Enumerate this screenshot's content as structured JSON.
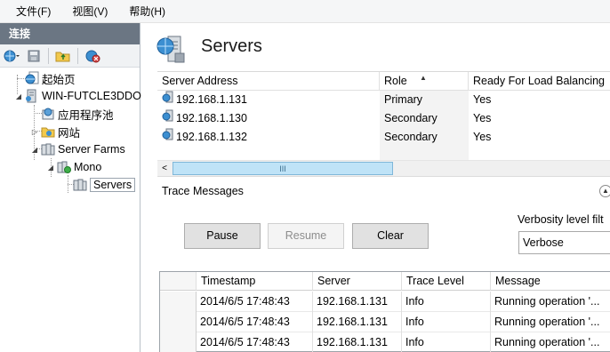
{
  "menu": {
    "items": [
      {
        "label": "文件(F)"
      },
      {
        "label": "视图(V)"
      },
      {
        "label": "帮助(H)"
      }
    ]
  },
  "left_pane": {
    "header": "连接",
    "toolbar_icons": [
      "globe-dropdown-icon",
      "save-icon",
      "folder-up-icon",
      "disconnect-icon"
    ],
    "tree": [
      {
        "label": "起始页",
        "icon": "globe-page-icon"
      },
      {
        "label": "WIN-FUTCLE3DDO",
        "icon": "server-icon"
      },
      {
        "label": "应用程序池",
        "icon": "app-pool-icon"
      },
      {
        "label": "网站",
        "icon": "sites-folder-icon"
      },
      {
        "label": "Server Farms",
        "icon": "server-farm-icon"
      },
      {
        "label": "Mono",
        "icon": "farm-node-icon"
      },
      {
        "label": "Servers",
        "icon": "servers-icon"
      }
    ]
  },
  "main": {
    "title": "Servers",
    "servers_grid": {
      "columns": [
        "Server Address",
        "Role",
        "Ready For Load Balancing"
      ],
      "rows": [
        {
          "address": "192.168.1.131",
          "role": "Primary",
          "ready": "Yes"
        },
        {
          "address": "192.168.1.130",
          "role": "Secondary",
          "ready": "Yes"
        },
        {
          "address": "192.168.1.132",
          "role": "Secondary",
          "ready": "Yes"
        }
      ],
      "scroll_left_glyph": "<",
      "scroll_thumb_glyph": "III"
    },
    "trace": {
      "title": "Trace Messages",
      "buttons": {
        "pause": "Pause",
        "resume": "Resume",
        "clear": "Clear"
      },
      "verbosity_label": "Verbosity level filt",
      "verbosity_value": "Verbose",
      "columns": [
        "Timestamp",
        "Server",
        "Trace Level",
        "Message"
      ],
      "rows": [
        {
          "timestamp": "2014/6/5 17:48:43",
          "server": "192.168.1.131",
          "level": "Info",
          "message": "Running operation '..."
        },
        {
          "timestamp": "2014/6/5 17:48:43",
          "server": "192.168.1.131",
          "level": "Info",
          "message": "Running operation '..."
        },
        {
          "timestamp": "2014/6/5 17:48:43",
          "server": "192.168.1.131",
          "level": "Info",
          "message": "Running operation '..."
        }
      ]
    }
  },
  "colors": {
    "header_bg": "#6b7683",
    "selection_thumb": "#bfe3f7",
    "button_bg": "#e1e1e1"
  }
}
